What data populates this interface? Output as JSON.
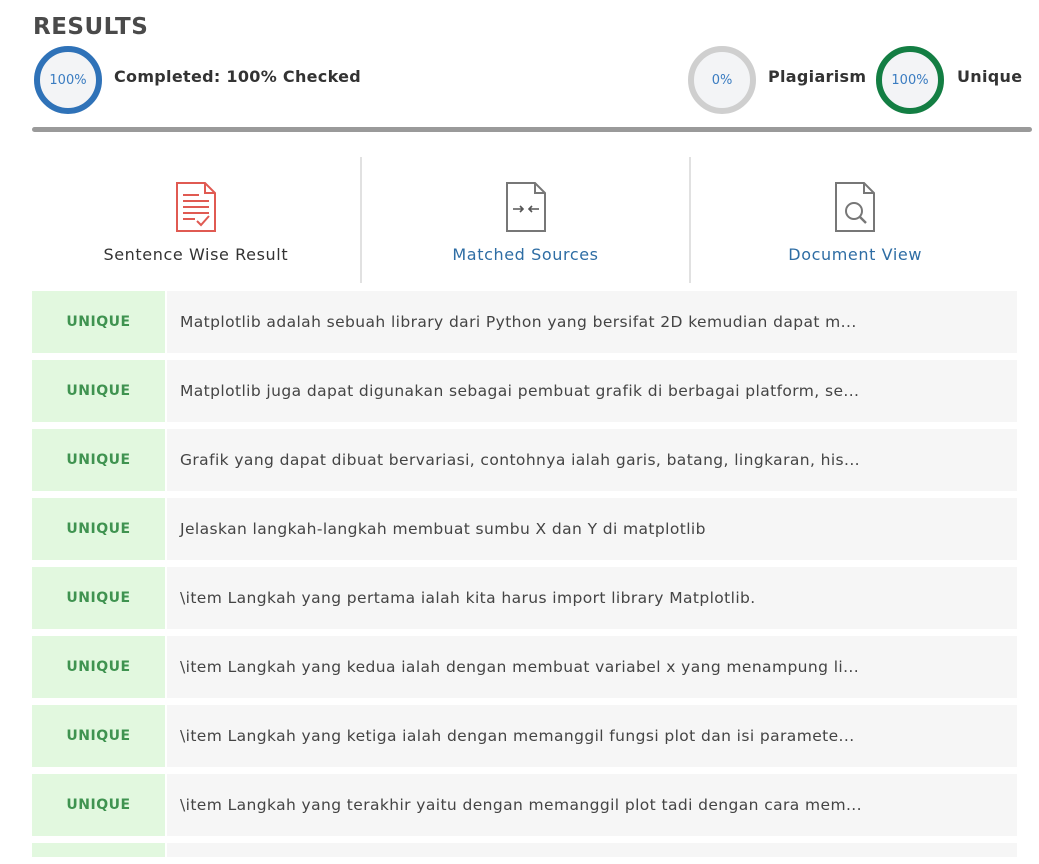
{
  "header": {
    "title": "RESULTS",
    "completed": {
      "percent": "100%",
      "label": "Completed: 100% Checked"
    },
    "plagiarism": {
      "percent": "0%",
      "label": "Plagiarism"
    },
    "unique": {
      "percent": "100%",
      "label": "Unique"
    }
  },
  "tabs": [
    {
      "label": "Sentence Wise Result",
      "icon": "document-check-icon"
    },
    {
      "label": "Matched Sources",
      "icon": "document-compare-icon"
    },
    {
      "label": "Document View",
      "icon": "document-search-icon"
    }
  ],
  "colors": {
    "completed_ring": "#2f72b8",
    "plagiarism_ring": "#cfcfcf",
    "unique_ring": "#137e43",
    "badge_bg": "#e2f8df",
    "badge_text": "#3f9350",
    "link": "#2e6da4"
  },
  "results": [
    {
      "status": "UNIQUE",
      "text": "Matplotlib adalah sebuah library dari Python yang bersifat 2D kemudian dapat m..."
    },
    {
      "status": "UNIQUE",
      "text": "Matplotlib juga dapat digunakan sebagai pembuat grafik di berbagai platform, se..."
    },
    {
      "status": "UNIQUE",
      "text": "Grafik yang dapat dibuat bervariasi, contohnya ialah garis, batang, lingkaran, his..."
    },
    {
      "status": "UNIQUE",
      "text": "Jelaskan langkah-langkah membuat sumbu X dan Y di matplotlib"
    },
    {
      "status": "UNIQUE",
      "text": "\\item Langkah yang pertama ialah kita harus import library Matplotlib."
    },
    {
      "status": "UNIQUE",
      "text": "\\item Langkah yang kedua ialah dengan membuat variabel x yang menampung li..."
    },
    {
      "status": "UNIQUE",
      "text": "\\item Langkah yang ketiga ialah dengan memanggil fungsi plot dan isi paramete..."
    },
    {
      "status": "UNIQUE",
      "text": "\\item Langkah yang terakhir yaitu dengan memanggil plot tadi dengan cara mem..."
    }
  ]
}
